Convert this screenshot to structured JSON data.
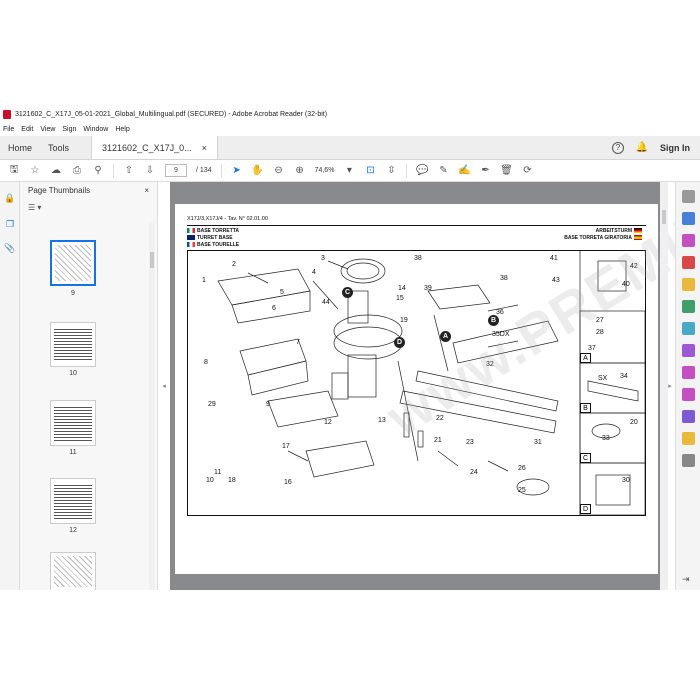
{
  "window": {
    "title": "3121602_C_X17J_05-01-2021_Global_Multilingual.pdf (SECURED) - Adobe Acrobat Reader (32-bit)"
  },
  "menu": [
    "File",
    "Edit",
    "View",
    "Sign",
    "Window",
    "Help"
  ],
  "tabs": {
    "home": "Home",
    "tools": "Tools",
    "document": "3121602_C_X17J_0...",
    "close": "×"
  },
  "header_right": {
    "help": "?",
    "bell": "🔔",
    "signin": "Sign In"
  },
  "toolbar": {
    "page_current": "9",
    "page_total": "/ 134",
    "zoom": "74,6%"
  },
  "thumbnails": {
    "title": "Page Thumbnails",
    "close": "×",
    "pages": [
      "9",
      "10",
      "11",
      "12"
    ]
  },
  "document_page": {
    "header": "X17J/3,X17J/4 - Tav. N° 02.01.00",
    "labels_left": [
      "BASE TORRETTA",
      "TURRET BASE",
      "BASE TOURELLE"
    ],
    "labels_right": [
      "ARBEITSTURM",
      "BASE TORRETA GIRATORIA"
    ],
    "watermark": "www.PREMIUMEPC.COM",
    "callouts": [
      "1",
      "2",
      "3",
      "4",
      "5",
      "6",
      "7",
      "8",
      "9",
      "10",
      "11",
      "12",
      "13",
      "14",
      "15",
      "16",
      "17",
      "18",
      "19",
      "20",
      "21",
      "22",
      "23",
      "24",
      "25",
      "26",
      "27",
      "28",
      "29",
      "30",
      "31",
      "32",
      "33",
      "34",
      "35DX",
      "36",
      "37",
      "38",
      "39",
      "40",
      "41",
      "42",
      "43",
      "44",
      "SX"
    ],
    "circle_labels": [
      "A",
      "B",
      "C",
      "D"
    ],
    "inset_letters": [
      "A",
      "B",
      "C",
      "D"
    ]
  },
  "colors": {
    "accent": "#1473e6",
    "doc_background": "#888a8e",
    "app_icon": "#c8102e"
  }
}
